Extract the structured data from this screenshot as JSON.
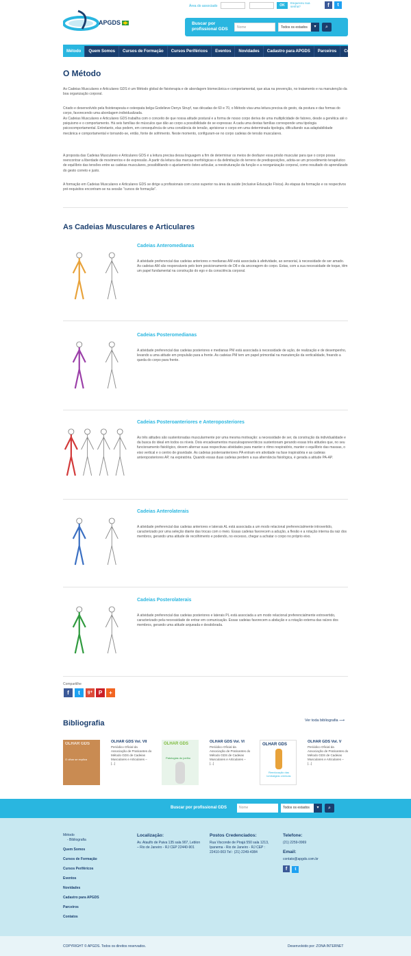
{
  "header": {
    "logo_text": "APGDS",
    "login": {
      "label": "Área do associado",
      "ok": "OK",
      "forgot": "Esqueceu sua senha?"
    },
    "search": {
      "title": "Buscar por profissional GDS",
      "name_placeholder": "Nome",
      "state_select": "Todos os estados"
    }
  },
  "nav": [
    "Método",
    "Quem Somos",
    "Cursos de Formação",
    "Cursos Periféricos",
    "Eventos",
    "Novidades",
    "Cadastro para APGDS",
    "Parceiros",
    "Contatos"
  ],
  "intro": {
    "title": "O Método",
    "paragraphs": [
      "As Cadeias Musculares e Articulares GDS é um Método global de fisioterapia e de abordagem biomecânica e comportamental, que atua na prevenção, no tratamento e na manutenção da boa organização corporal.",
      "Criado e desenvolvido pela fisioterapeuta e osteopata belga Godelieve Denys Struyf, nas décadas de 60 e 70, o Método visa uma leitura precisa do gesto, da postura e das formas do corpo, favorecendo uma abordagem individualizada.",
      "As Cadeias Musculares e Articulares GDS trabalha com o conceito de que nossa atitude postural e a forma de nosso corpo deriva de uma multiplicidade de fatores, desde a genética até o psiquismo e o comportamento. Há seis famílias de músculos que dão ao corpo a possibilidade de se expressar. A cada uma destas famílias corresponde uma tipologia psicocomportamental. Entretanto, elas podem, em consequência de uma constância de tensão, aprisionar o corpo em uma determinada tipologia, dificultando sua adaptabilidade mecânica e comportamental e tornando-se, então, fonte de sofrimento. Neste momento, configuram-se no corpo cadeias de tensão musculares.",
      "A proposta das Cadeias Musculares e Articulares GDS é a leitura precisa dessa linguagem a fim de determinar os meios de desfazer essa prisão muscular para que o corpo possa reencontrar a liberdade de movimentos e de expressão. A partir da leitura das marcas morfológicas e da delimitação do terreno de predisposições, adota-se um procedimento terapêutico de equilíbrio das tensões entre as cadeias musculares, possibilitando o ajustamento ósteo-articular, a reestruturação da função e a reorganização corporal, como resultado do aprendizado do gesto correto e justo.",
      "A formação em Cadeias Musculares e Articulares GDS se dirige a profissionais com curso superior na área da saúde (inclusive Educação Física). As etapas da formação e os respectivos pré-requisitos encontram-se na sessão \"cursos de formação\"."
    ]
  },
  "chains": {
    "title": "As Cadeias Musculares e Articulares",
    "items": [
      {
        "title": "Cadeias Anteromedianas",
        "color": "#e8a23a",
        "text": "A atividade preferencial das cadeias anteriores e medianas AM está associada à afetividade, ao sensorial, à necessidade de ser amado. As cadeias AM são responsáveis pelo bom posicionamento de D8 e da ancoragem do corpo. Estas, com a sua necessidade de toque, têm um papel fundamental na construção do ego e da consciência corporal."
      },
      {
        "title": "Cadeias Posteromedianas",
        "color": "#9b3fa8",
        "text": "A atividade preferencial das cadeias posteriores e medianas PM está associada à necessidade de ação, de realização e de desempenho, levando a uma atitude em propulsão para a frente. As cadeias PM tem um papel primordial na manutenção da verticalidade, freando a queda do corpo para frente."
      },
      {
        "title": "Cadeias Posteroanteriores e Anteroposteriores",
        "color": "#d23a3a",
        "text": "As três atitudes são sustentonadas muscularmente por uma mesma motivação: a necessidade de ser, da construção da individualidade e da busca do ideal em todos os níveis. Dois encadeamentos musculoaponevróticos sustentonam gerando essas três atitudes que, no seu funcionamento fisiológico, devem alternar suas respectivas atividades para manter o ritmo respiratório, manter o equilíbrio das massas, o eixo vertical e o centro de gravidade. As cadeias posteroanteriores PA entram em atividade na fase inspiratória e as cadeias anteroposteriores AP, na expiratória. Quando essas duas cadeias perdem a sua alternância fisiológica, é gerada a atitude PA-AP."
      },
      {
        "title": "Cadeias Anterolaterais",
        "color": "#3a6fc2",
        "text": "A atividade preferencial das cadeias anteriores e laterais AL está associada a um modo relacional preferencialmente introvertido, caracterizado por uma seleção diante das trocas com o meio. Essas cadeias favorecem a adução, a flexão e a rotação interna da raiz dos membros, gerando uma atitude de recolhimento e podendo, no excesso, chegar a achatar o corpo no próprio eixo."
      },
      {
        "title": "Cadeias Posterolaterais",
        "color": "#2f9a3e",
        "text": "A atividade preferencial das cadeias posteriores e laterais PL está associada a um modo relacional preferencialmente extrovertido, caracterizado pela necessidade de entrar em comunicação. Essas cadeias favorecem a abdução e a rotação externa das raízes dos membros, gerando uma atitude arqueada e desdobrada."
      }
    ]
  },
  "share": {
    "label": "Compartilhe",
    "buttons": [
      {
        "g": "f",
        "c": "#3b5998"
      },
      {
        "g": "t",
        "c": "#1da1f2"
      },
      {
        "g": "g+",
        "c": "#dd4b39"
      },
      {
        "g": "P",
        "c": "#cb2027"
      },
      {
        "g": "+",
        "c": "#f26522"
      }
    ]
  },
  "bibliography": {
    "title": "Bibliografia",
    "see_all": "Ver toda bibliografia ⟶",
    "books": [
      {
        "title": "OLHAR GDS Vol. VII",
        "desc": "Periódico Oficial da Associação de Praticantes do Método GDS de Cadeias Musculares e Articulares – [...]",
        "cover_title": "OLHAR GDS",
        "cover_sub": "O olhar se explica"
      },
      {
        "title": "OLHAR GDS Vol. VI",
        "desc": "Periódico Oficial da Associação de Praticantes do Método GDS de Cadeias Musculares e Articulares – [...]",
        "cover_title": "OLHAR GDS",
        "cover_sub": "Patologias do joelho"
      },
      {
        "title": "OLHAR GDS Vol. V",
        "desc": "Periódico Oficial da Associação de Praticantes do Método GDS de Cadeias Musculares e Articulares – [...]",
        "cover_title": "OLHAR GDS",
        "cover_sub": "Reeducação das lombalgias crônicas"
      }
    ]
  },
  "footer_search": {
    "title": "Buscar por profissional GDS",
    "name_placeholder": "Nome",
    "state_select": "Todos os estados"
  },
  "footer": {
    "links": [
      "Método",
      "- Bibliografia",
      "Quem Somos",
      "Cursos de Formação",
      "Cursos Periféricos",
      "Eventos",
      "Novidades",
      "Cadastro para APGDS",
      "Parceiros",
      "Contatos"
    ],
    "location": {
      "title": "Localização:",
      "text": "Av. Ataulfo de Paiva 135 sala 907, Leblon – Rio de Janeiro - RJ CEP 22440-901"
    },
    "post": {
      "title": "Postos Credenciados:",
      "text": "Rua Visconde de Pirajá 550 sala 1213, Ipanema - Rio de Janeiro - RJ CEP : 22410-003 Tel : (21) 2249-4384"
    },
    "phone": {
      "title": "Telefone:",
      "text": "(21) 2259-0969"
    },
    "email": {
      "title": "Email:",
      "text": "contato@apgds.com.br"
    }
  },
  "copyright": {
    "left": "COPYRIGHT © APGDS. Todos os direitos reservados.",
    "right": "Desenvolvido por: ZONA INTERNET"
  }
}
